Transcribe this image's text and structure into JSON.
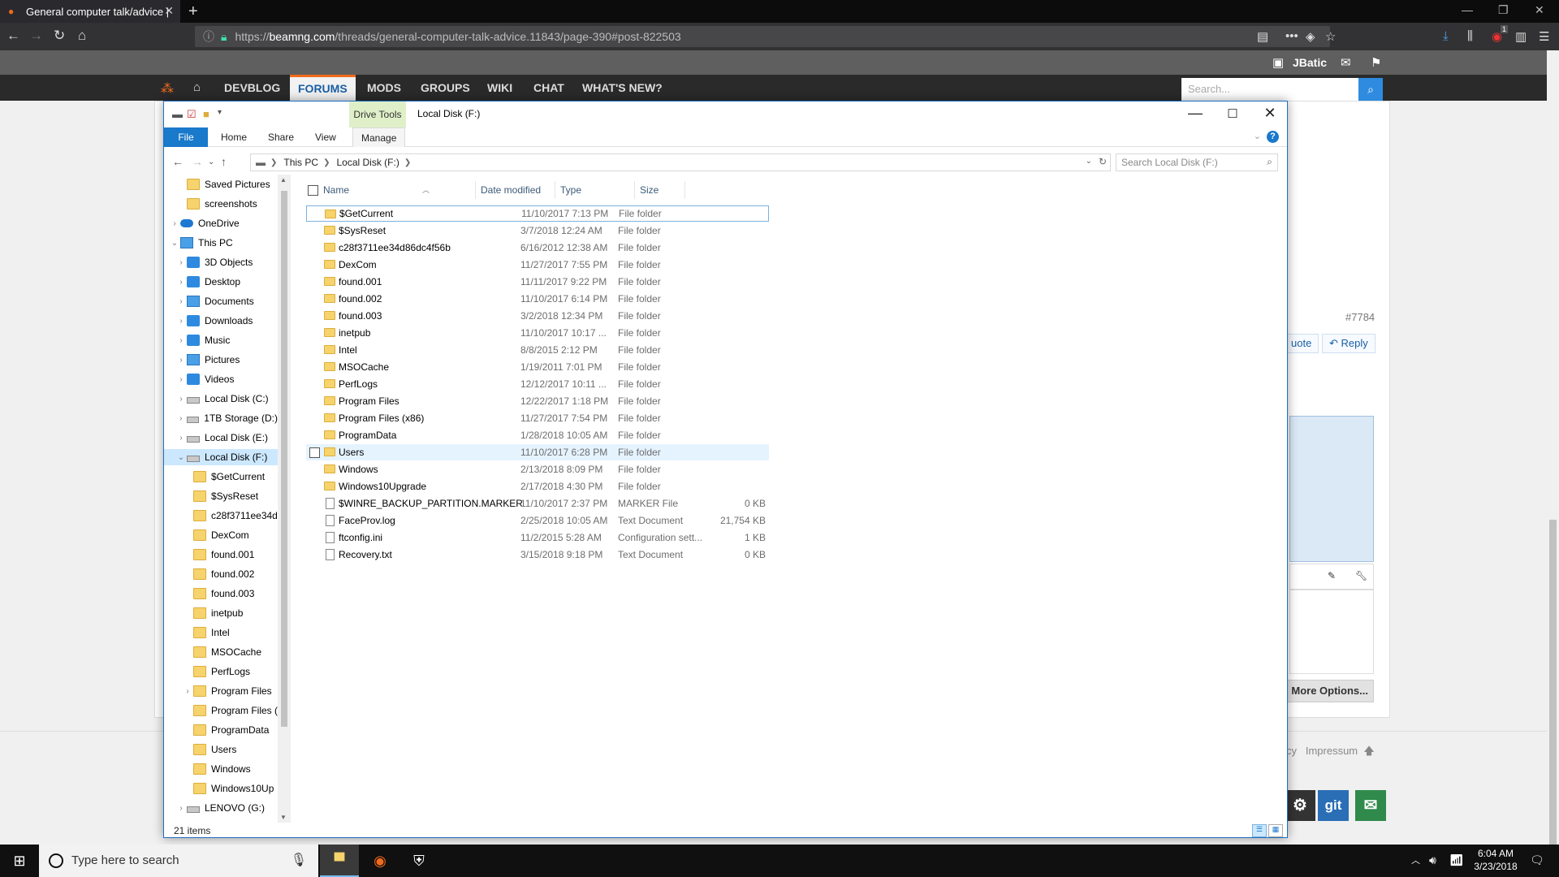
{
  "browser": {
    "tab_title": "General computer talk/advice |",
    "url_prefix": "https://",
    "url_host": "beamng.com",
    "url_path": "/threads/general-computer-talk-advice.11843/page-390#post-822503",
    "badge_count": "1"
  },
  "forum": {
    "username": "JBatic",
    "nav": [
      "DEVBLOG",
      "FORUMS",
      "MODS",
      "GROUPS",
      "WIKI",
      "CHAT",
      "WHAT'S NEW?"
    ],
    "search_placeholder": "Search...",
    "post_number": "#7784",
    "quote_label": "uote",
    "reply_label": "Reply",
    "more_options": "More Options...",
    "footer_cy": "cy",
    "footer_impressum": "Impressum",
    "git_label": "git"
  },
  "explorer": {
    "drive_tools": "Drive Tools",
    "window_title": "Local Disk (F:)",
    "ribbon_tabs": [
      "File",
      "Home",
      "Share",
      "View",
      "Manage"
    ],
    "breadcrumb": [
      "This PC",
      "Local Disk (F:)"
    ],
    "search_placeholder": "Search Local Disk (F:)",
    "columns": [
      "Name",
      "Date modified",
      "Type",
      "Size"
    ],
    "nav_tree": [
      {
        "label": "Saved Pictures",
        "icon": "folder-icon",
        "indent": 1
      },
      {
        "label": "screenshots",
        "icon": "folder-icon",
        "indent": 1
      },
      {
        "label": "OneDrive",
        "icon": "cloud-icon",
        "indent": 0
      },
      {
        "label": "This PC",
        "icon": "computer-icon",
        "indent": 0
      },
      {
        "label": "3D Objects",
        "icon": "folder-3d-icon",
        "indent": 1
      },
      {
        "label": "Desktop",
        "icon": "desktop-icon",
        "indent": 1
      },
      {
        "label": "Documents",
        "icon": "documents-icon",
        "indent": 1
      },
      {
        "label": "Downloads",
        "icon": "downloads-icon",
        "indent": 1
      },
      {
        "label": "Music",
        "icon": "music-icon",
        "indent": 1
      },
      {
        "label": "Pictures",
        "icon": "pictures-icon",
        "indent": 1
      },
      {
        "label": "Videos",
        "icon": "videos-icon",
        "indent": 1
      },
      {
        "label": "Local Disk (C:)",
        "icon": "drive-icon",
        "indent": 1
      },
      {
        "label": "1TB Storage (D:)",
        "icon": "drive-icon",
        "indent": 1
      },
      {
        "label": "Local Disk (E:)",
        "icon": "drive-icon",
        "indent": 1
      },
      {
        "label": "Local Disk (F:)",
        "icon": "drive-icon",
        "indent": 1
      },
      {
        "label": "$GetCurrent",
        "icon": "folder-icon",
        "indent": 2
      },
      {
        "label": "$SysReset",
        "icon": "folder-icon",
        "indent": 2
      },
      {
        "label": "c28f3711ee34d",
        "icon": "folder-icon",
        "indent": 2
      },
      {
        "label": "DexCom",
        "icon": "folder-icon",
        "indent": 2
      },
      {
        "label": "found.001",
        "icon": "folder-icon",
        "indent": 2
      },
      {
        "label": "found.002",
        "icon": "folder-icon",
        "indent": 2
      },
      {
        "label": "found.003",
        "icon": "folder-icon",
        "indent": 2
      },
      {
        "label": "inetpub",
        "icon": "folder-icon",
        "indent": 2
      },
      {
        "label": "Intel",
        "icon": "folder-icon",
        "indent": 2
      },
      {
        "label": "MSOCache",
        "icon": "folder-icon",
        "indent": 2
      },
      {
        "label": "PerfLogs",
        "icon": "folder-icon",
        "indent": 2
      },
      {
        "label": "Program Files",
        "icon": "folder-icon",
        "indent": 2
      },
      {
        "label": "Program Files (",
        "icon": "folder-icon",
        "indent": 2
      },
      {
        "label": "ProgramData",
        "icon": "folder-icon",
        "indent": 2
      },
      {
        "label": "Users",
        "icon": "folder-icon",
        "indent": 2
      },
      {
        "label": "Windows",
        "icon": "folder-icon",
        "indent": 2
      },
      {
        "label": "Windows10Up",
        "icon": "folder-icon",
        "indent": 2
      },
      {
        "label": "LENOVO (G:)",
        "icon": "drive-icon",
        "indent": 1
      }
    ],
    "files": [
      {
        "name": "$GetCurrent",
        "date": "11/10/2017 7:13 PM",
        "type": "File folder",
        "size": "",
        "kind": "folder"
      },
      {
        "name": "$SysReset",
        "date": "3/7/2018 12:24 AM",
        "type": "File folder",
        "size": "",
        "kind": "folder"
      },
      {
        "name": "c28f3711ee34d86dc4f56b",
        "date": "6/16/2012 12:38 AM",
        "type": "File folder",
        "size": "",
        "kind": "folder"
      },
      {
        "name": "DexCom",
        "date": "11/27/2017 7:55 PM",
        "type": "File folder",
        "size": "",
        "kind": "folder"
      },
      {
        "name": "found.001",
        "date": "11/11/2017 9:22 PM",
        "type": "File folder",
        "size": "",
        "kind": "folder"
      },
      {
        "name": "found.002",
        "date": "11/10/2017 6:14 PM",
        "type": "File folder",
        "size": "",
        "kind": "folder"
      },
      {
        "name": "found.003",
        "date": "3/2/2018 12:34 PM",
        "type": "File folder",
        "size": "",
        "kind": "folder"
      },
      {
        "name": "inetpub",
        "date": "11/10/2017 10:17 ...",
        "type": "File folder",
        "size": "",
        "kind": "folder"
      },
      {
        "name": "Intel",
        "date": "8/8/2015 2:12 PM",
        "type": "File folder",
        "size": "",
        "kind": "folder"
      },
      {
        "name": "MSOCache",
        "date": "1/19/2011 7:01 PM",
        "type": "File folder",
        "size": "",
        "kind": "folder"
      },
      {
        "name": "PerfLogs",
        "date": "12/12/2017 10:11 ...",
        "type": "File folder",
        "size": "",
        "kind": "folder"
      },
      {
        "name": "Program Files",
        "date": "12/22/2017 1:18 PM",
        "type": "File folder",
        "size": "",
        "kind": "folder"
      },
      {
        "name": "Program Files (x86)",
        "date": "11/27/2017 7:54 PM",
        "type": "File folder",
        "size": "",
        "kind": "folder"
      },
      {
        "name": "ProgramData",
        "date": "1/28/2018 10:05 AM",
        "type": "File folder",
        "size": "",
        "kind": "folder"
      },
      {
        "name": "Users",
        "date": "11/10/2017 6:28 PM",
        "type": "File folder",
        "size": "",
        "kind": "folder"
      },
      {
        "name": "Windows",
        "date": "2/13/2018 8:09 PM",
        "type": "File folder",
        "size": "",
        "kind": "folder"
      },
      {
        "name": "Windows10Upgrade",
        "date": "2/17/2018 4:30 PM",
        "type": "File folder",
        "size": "",
        "kind": "folder"
      },
      {
        "name": "$WINRE_BACKUP_PARTITION.MARKER",
        "date": "11/10/2017 2:37 PM",
        "type": "MARKER File",
        "size": "0 KB",
        "kind": "file"
      },
      {
        "name": "FaceProv.log",
        "date": "2/25/2018 10:05 AM",
        "type": "Text Document",
        "size": "21,754 KB",
        "kind": "file"
      },
      {
        "name": "ftconfig.ini",
        "date": "11/2/2015 5:28 AM",
        "type": "Configuration sett...",
        "size": "1 KB",
        "kind": "file"
      },
      {
        "name": "Recovery.txt",
        "date": "3/15/2018 9:18 PM",
        "type": "Text Document",
        "size": "0 KB",
        "kind": "file"
      }
    ],
    "status": "21 items"
  },
  "taskbar": {
    "search_placeholder": "Type here to search",
    "time": "6:04 AM",
    "date": "3/23/2018"
  },
  "colors": {
    "accent_blue": "#1979ca",
    "beamng_orange": "#f26a1b",
    "selection": "#cce8ff"
  }
}
